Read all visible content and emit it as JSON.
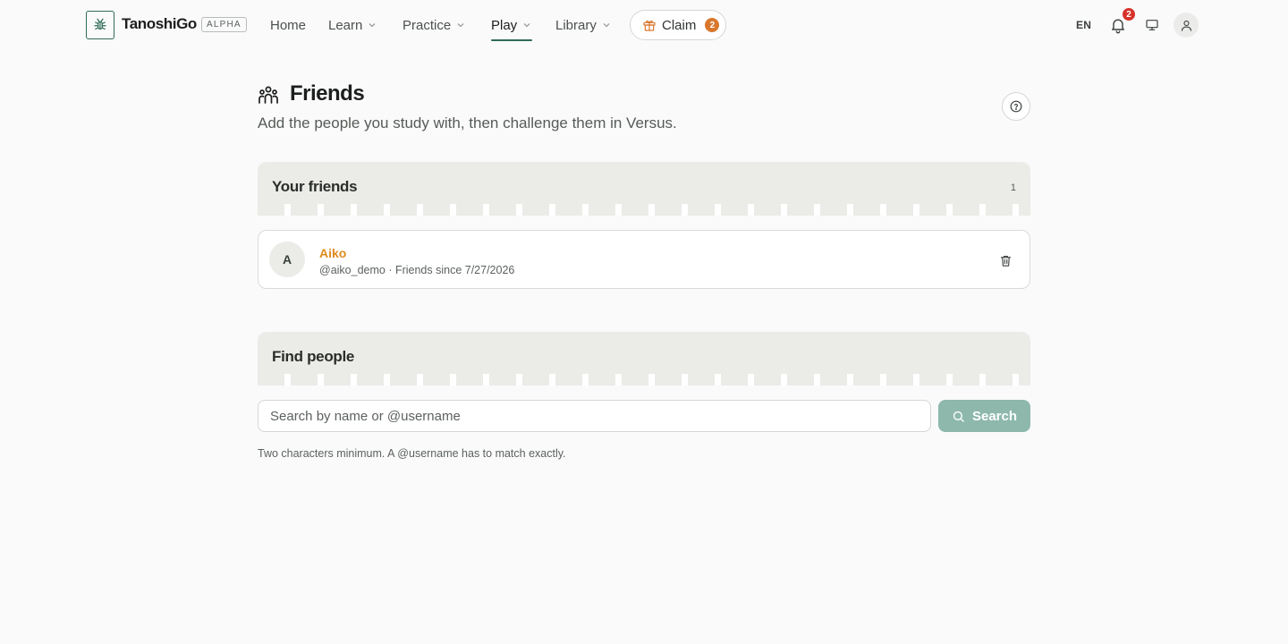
{
  "header": {
    "brand": "TanoshiGo",
    "badge": "ALPHA",
    "nav": [
      {
        "label": "Home"
      },
      {
        "label": "Learn"
      },
      {
        "label": "Practice"
      },
      {
        "label": "Play",
        "active": true
      },
      {
        "label": "Library"
      }
    ],
    "claim": {
      "label": "Claim",
      "count": "2"
    },
    "language": "EN",
    "notifications_count": "2",
    "icons": [
      "bug-logo-icon",
      "gift-icon",
      "bell-icon",
      "monitor-icon",
      "user-icon",
      "chevron-down-icon"
    ]
  },
  "page": {
    "title": "Friends",
    "subtitle": "Add the people you study with, then challenge them in Versus.",
    "title_icon": "friends-icon",
    "help_icon": "question-circle-icon"
  },
  "friends_section": {
    "title": "Your friends",
    "count": "1",
    "friends": [
      {
        "initial": "A",
        "name": "Aiko",
        "meta": "@aiko_demo · Friends since 7/27/2026"
      }
    ]
  },
  "find_section": {
    "title": "Find people",
    "search_placeholder": "Search by name or @username",
    "search_value": "",
    "search_button": "Search",
    "hint": "Two characters minimum. A @username has to match exactly."
  },
  "colors": {
    "brand_green": "#2f6b57",
    "accent_orange": "#e08a1e",
    "claim_badge": "#d9782d",
    "notification_badge": "#d6322a",
    "search_button": "#8db8ab",
    "section_header_bg": "#ebece8"
  }
}
